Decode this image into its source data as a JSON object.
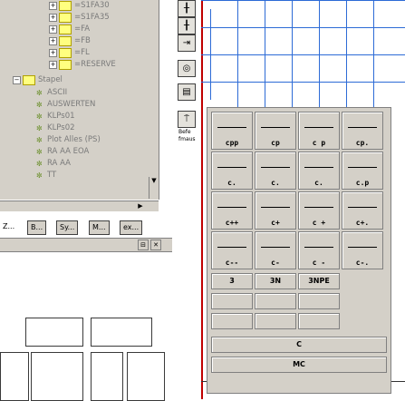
{
  "tree": {
    "folders": [
      {
        "label": "=S1FA30"
      },
      {
        "label": "=S1FA35"
      },
      {
        "label": "=FA"
      },
      {
        "label": "=FB"
      },
      {
        "label": "=FL"
      },
      {
        "label": "=RESERVE"
      }
    ],
    "root": {
      "label": "Stapel"
    },
    "items": [
      {
        "label": "ASCII"
      },
      {
        "label": "AUSWERTEN"
      },
      {
        "label": "KLPs01"
      },
      {
        "label": "KLPs02"
      },
      {
        "label": "Plot Alles (PS)"
      },
      {
        "label": "RA AA EOA"
      },
      {
        "label": "RA AA"
      },
      {
        "label": "TT"
      }
    ]
  },
  "tabs": [
    "B...",
    "Sy...",
    "M...",
    "ex..."
  ],
  "tabs_prefix": "Z...",
  "toolbar": {
    "buttons": [
      "plus-icon",
      "plus-icon",
      "arrow-plus-icon",
      "target-icon",
      "form-icon",
      "antenna-icon"
    ],
    "side_labels": [
      "Befe",
      "fmaus"
    ]
  },
  "palette": {
    "rows": [
      [
        "cpp",
        "cp",
        "c p",
        "cp."
      ],
      [
        "c.",
        "c.",
        "c.",
        "c.p"
      ],
      [
        "c++",
        "c+",
        "c +",
        "c+."
      ],
      [
        "c--",
        "c-",
        "c -",
        "c-."
      ]
    ],
    "row_three": [
      "3",
      "3N",
      "3NPE"
    ],
    "single_c": "C",
    "single_mc": "MC"
  }
}
